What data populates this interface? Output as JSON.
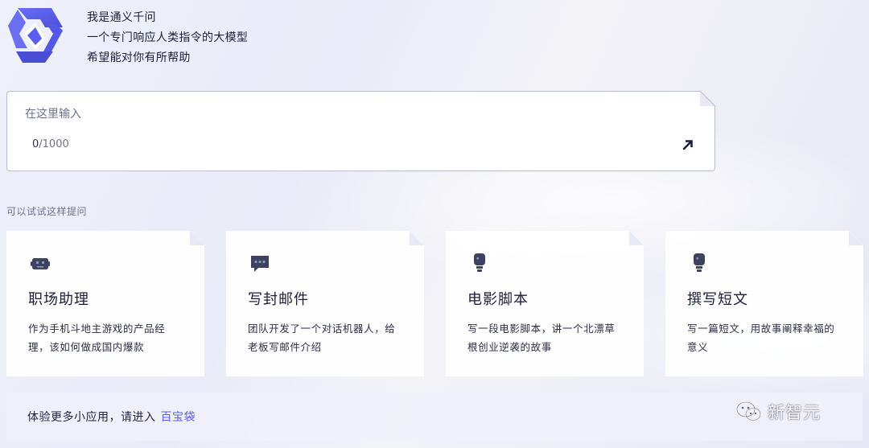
{
  "intro": {
    "line1": "我是通义千问",
    "line2": "一个专门响应人类指令的大模型",
    "line3": "希望能对你有所帮助"
  },
  "input": {
    "placeholder": "在这里输入",
    "value": "",
    "count": "0",
    "max": "/1000"
  },
  "hint": "可以试试这样提问",
  "cards": [
    {
      "title": "职场助理",
      "desc": "作为手机斗地主游戏的产品经理，该如何做成国内爆款",
      "icon": "robot-icon"
    },
    {
      "title": "写封邮件",
      "desc": "团队开发了一个对话机器人，给老板写邮件介绍",
      "icon": "chat-bubble-icon"
    },
    {
      "title": "电影脚本",
      "desc": "写一段电影脚本，讲一个北漂草根创业逆袭的故事",
      "icon": "lightbulb-icon"
    },
    {
      "title": "撰写短文",
      "desc": "写一篇短文，用故事阐释幸福的意义",
      "icon": "lightbulb-icon"
    }
  ],
  "footer": {
    "text": "体验更多小应用，请进入",
    "link": "百宝袋"
  },
  "watermark": "新智元",
  "colors": {
    "accent": "#5b5ff0",
    "logo": "#5b5ff0",
    "icon": "#3d4260"
  }
}
